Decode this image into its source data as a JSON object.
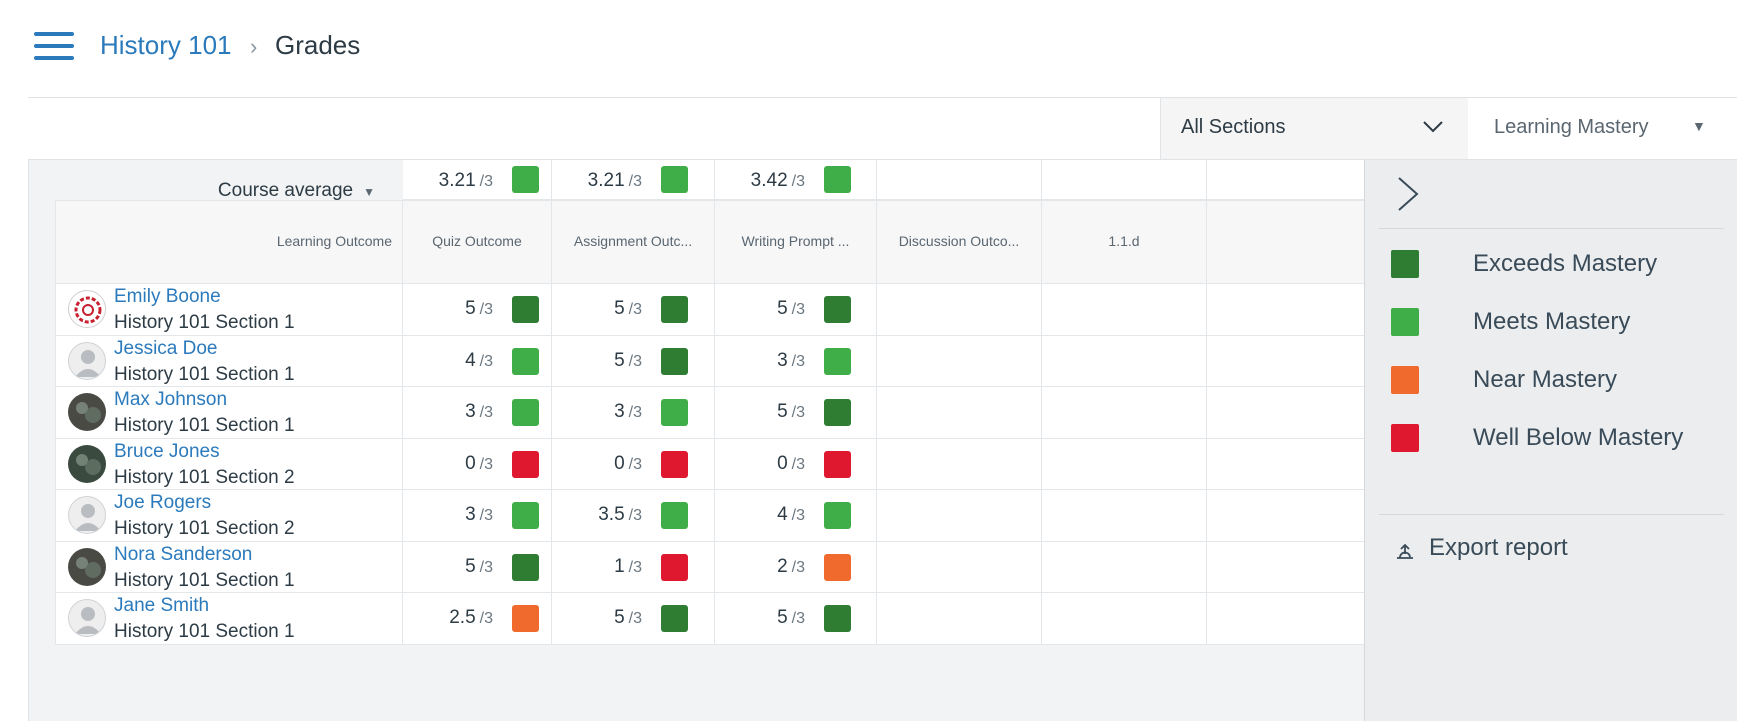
{
  "breadcrumb": {
    "course": "History 101",
    "separator": "›",
    "current": "Grades"
  },
  "filters": {
    "section_select": "All Sections",
    "view_menu": "Learning Mastery"
  },
  "colors": {
    "exceeds": "#2f7d32",
    "meets": "#3fae49",
    "near": "#f06a2e",
    "below": "#e0182f"
  },
  "grid": {
    "course_average_label": "Course average",
    "course_averages": [
      {
        "value": "3.21",
        "denom": "/3",
        "level": "meets"
      },
      {
        "value": "3.21",
        "denom": "/3",
        "level": "meets"
      },
      {
        "value": "3.42",
        "denom": "/3",
        "level": "meets"
      }
    ],
    "header_first": "Learning Outcome",
    "columns": [
      "Quiz Outcome",
      "Assignment Outc...",
      "Writing Prompt ...",
      "Discussion Outco...",
      "1.1.d"
    ],
    "students": [
      {
        "name": "Emily Boone",
        "section": "History 101 Section 1",
        "avatar": "seal-avatar",
        "scores": [
          {
            "value": "5",
            "denom": "/3",
            "level": "exceeds"
          },
          {
            "value": "5",
            "denom": "/3",
            "level": "exceeds"
          },
          {
            "value": "5",
            "denom": "/3",
            "level": "exceeds"
          }
        ]
      },
      {
        "name": "Jessica Doe",
        "section": "History 101 Section 1",
        "avatar": "default-avatar",
        "scores": [
          {
            "value": "4",
            "denom": "/3",
            "level": "meets"
          },
          {
            "value": "5",
            "denom": "/3",
            "level": "exceeds"
          },
          {
            "value": "3",
            "denom": "/3",
            "level": "meets"
          }
        ]
      },
      {
        "name": "Max Johnson",
        "section": "History 101 Section 1",
        "avatar": "photo-avatar",
        "scores": [
          {
            "value": "3",
            "denom": "/3",
            "level": "meets"
          },
          {
            "value": "3",
            "denom": "/3",
            "level": "meets"
          },
          {
            "value": "5",
            "denom": "/3",
            "level": "exceeds"
          }
        ]
      },
      {
        "name": "Bruce Jones",
        "section": "History 101 Section 2",
        "avatar": "photo-avatar",
        "scores": [
          {
            "value": "0",
            "denom": "/3",
            "level": "below"
          },
          {
            "value": "0",
            "denom": "/3",
            "level": "below"
          },
          {
            "value": "0",
            "denom": "/3",
            "level": "below"
          }
        ]
      },
      {
        "name": "Joe Rogers",
        "section": "History 101 Section 2",
        "avatar": "default-avatar",
        "scores": [
          {
            "value": "3",
            "denom": "/3",
            "level": "meets"
          },
          {
            "value": "3.5",
            "denom": "/3",
            "level": "meets"
          },
          {
            "value": "4",
            "denom": "/3",
            "level": "meets"
          }
        ]
      },
      {
        "name": "Nora Sanderson",
        "section": "History 101 Section 1",
        "avatar": "photo-avatar",
        "scores": [
          {
            "value": "5",
            "denom": "/3",
            "level": "exceeds"
          },
          {
            "value": "1",
            "denom": "/3",
            "level": "below"
          },
          {
            "value": "2",
            "denom": "/3",
            "level": "near"
          }
        ]
      },
      {
        "name": "Jane Smith",
        "section": "History 101 Section 1",
        "avatar": "default-avatar",
        "scores": [
          {
            "value": "2.5",
            "denom": "/3",
            "level": "near"
          },
          {
            "value": "5",
            "denom": "/3",
            "level": "exceeds"
          },
          {
            "value": "5",
            "denom": "/3",
            "level": "exceeds"
          }
        ]
      }
    ]
  },
  "legend": [
    {
      "label": "Exceeds Mastery",
      "level": "exceeds"
    },
    {
      "label": "Meets Mastery",
      "level": "meets"
    },
    {
      "label": "Near Mastery",
      "level": "near"
    },
    {
      "label": "Well Below Mastery",
      "level": "below"
    }
  ],
  "export_label": "Export report",
  "icons": {
    "menu": "hamburger-icon",
    "select": "chevron-down-icon",
    "collapse": "chevron-right-icon",
    "export": "export-icon"
  }
}
